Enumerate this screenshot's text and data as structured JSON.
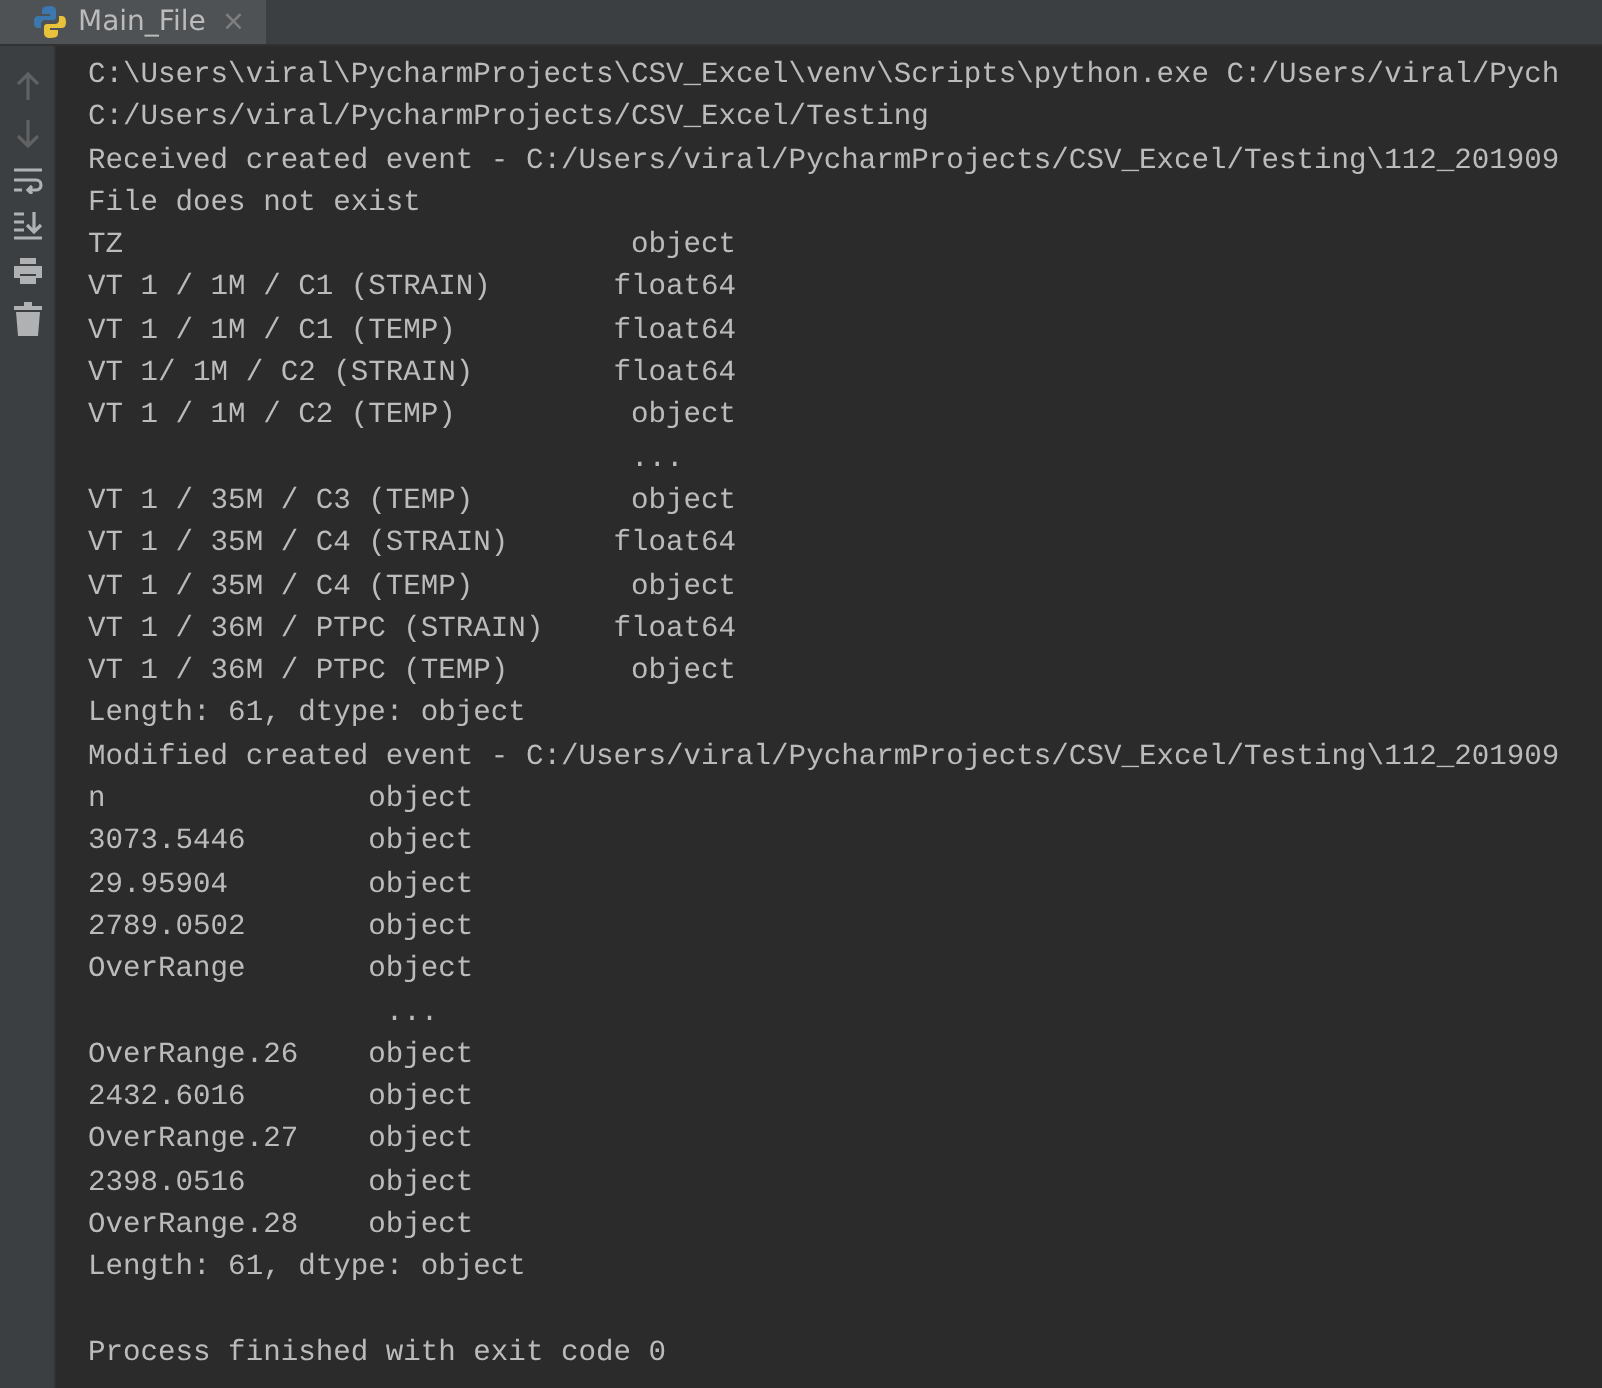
{
  "tab": {
    "title": "Main_File",
    "close": "×",
    "selected": true
  },
  "toolbar": [
    {
      "kind": "up",
      "disabled": true
    },
    {
      "kind": "down",
      "disabled": true
    },
    {
      "kind": "wrap",
      "disabled": false
    },
    {
      "kind": "scroll-end",
      "disabled": false
    },
    {
      "kind": "print",
      "disabled": false
    },
    {
      "kind": "trash",
      "disabled": false
    }
  ],
  "console": [
    "C:\\Users\\viral\\PycharmProjects\\CSV_Excel\\venv\\Scripts\\python.exe C:/Users/viral/Pych",
    "C:/Users/viral/PycharmProjects/CSV_Excel/Testing",
    "Received created event - C:/Users/viral/PycharmProjects/CSV_Excel/Testing\\112_201909",
    "File does not exist",
    "TZ                             object",
    "VT 1 / 1M / C1 (STRAIN)       float64",
    "VT 1 / 1M / C1 (TEMP)         float64",
    "VT 1/ 1M / C2 (STRAIN)        float64",
    "VT 1 / 1M / C2 (TEMP)          object",
    "                               ...",
    "VT 1 / 35M / C3 (TEMP)         object",
    "VT 1 / 35M / C4 (STRAIN)      float64",
    "VT 1 / 35M / C4 (TEMP)         object",
    "VT 1 / 36M / PTPC (STRAIN)    float64",
    "VT 1 / 36M / PTPC (TEMP)       object",
    "Length: 61, dtype: object",
    "Modified created event - C:/Users/viral/PycharmProjects/CSV_Excel/Testing\\112_201909",
    "n               object",
    "3073.5446       object",
    "29.95904        object",
    "2789.0502       object",
    "OverRange       object",
    "                 ...",
    "OverRange.26    object",
    "2432.6016       object",
    "OverRange.27    object",
    "2398.0516       object",
    "OverRange.28    object",
    "Length: 61, dtype: object"
  ],
  "exit_message": "Process finished with exit code 0"
}
